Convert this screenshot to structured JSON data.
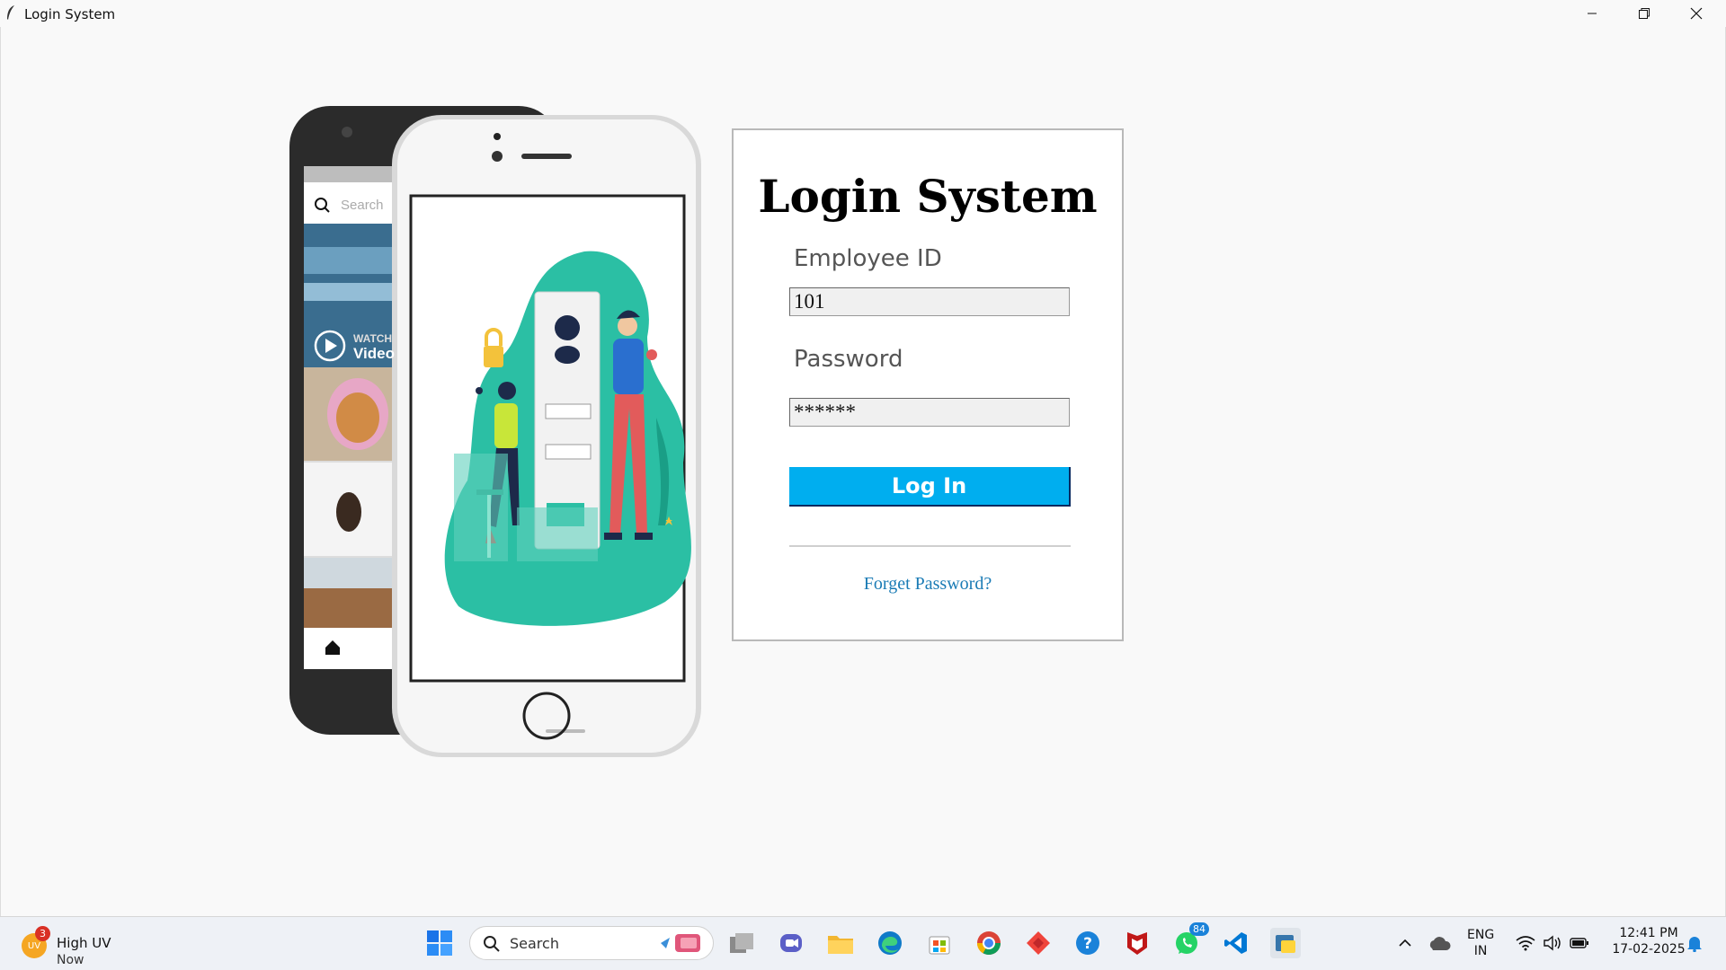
{
  "window": {
    "title": "Login System",
    "controls": [
      "minimize",
      "restore",
      "close"
    ]
  },
  "illustration": {
    "back_phone_search_placeholder": "Search",
    "back_phone_watch_label": "WATCH",
    "back_phone_video_label": "Video"
  },
  "login": {
    "heading": "Login System",
    "employee_label": "Employee ID",
    "employee_value": "101",
    "password_label": "Password",
    "password_value": "******",
    "button_label": "Log In",
    "forgot_label": "Forget Password?"
  },
  "taskbar": {
    "weather_title": "High UV",
    "weather_sub": "Now",
    "weather_icon_text": "UV",
    "weather_badge": "3",
    "search_label": "Search",
    "whatsapp_badge": "84",
    "language": "ENG",
    "region": "IN",
    "time": "12:41 PM",
    "date": "17-02-2025"
  },
  "colors": {
    "accent_button": "#00aeef",
    "link": "#1a7bb5",
    "illustration_teal": "#2bbfa4"
  }
}
